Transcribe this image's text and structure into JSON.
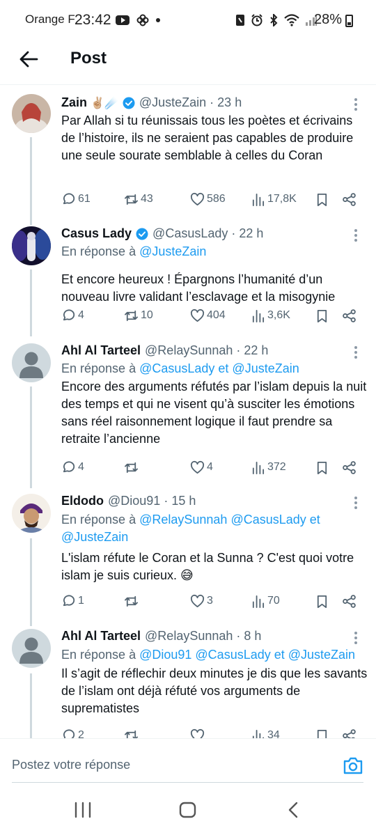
{
  "status_bar": {
    "carrier": "Orange F",
    "time": "23:42",
    "battery": "28%"
  },
  "header": {
    "title": "Post"
  },
  "tweets": [
    {
      "name": "Zain",
      "name_emoji": "✌🏼☄️",
      "verified": true,
      "handle": "@JusteZain",
      "time": "· 23 h",
      "reply_prefix": "",
      "reply_mentions": [],
      "text": "Par Allah si tu réunissais tous les poètes et écrivains de l’histoire, ils ne seraient pas capables de produire une seule sourate semblable à celles du Coran",
      "replies": "61",
      "retweets": "43",
      "likes": "586",
      "views": "17,8K"
    },
    {
      "name": "Casus Lady",
      "verified": true,
      "handle": "@CasusLady",
      "time": "· 22 h",
      "reply_prefix": "En réponse à",
      "reply_mentions": [
        "@JusteZain"
      ],
      "text": "Et encore heureux ! Épargnons l’humanité d’un nouveau livre validant l’esclavage et la misogynie",
      "replies": "4",
      "retweets": "10",
      "likes": "404",
      "views": "3,6K"
    },
    {
      "name": "Ahl Al Tarteel",
      "verified": false,
      "handle": "@RelaySunnah",
      "time": "· 22 h",
      "reply_prefix": "En réponse à",
      "reply_line1": "@CasusLady et @JusteZain",
      "text": "Encore des arguments réfutés par l’islam depuis la nuit des temps et qui ne visent qu’à susciter les émotions sans réel raisonnement logique il faut prendre sa retraite l’ancienne",
      "replies": "4",
      "retweets": "",
      "likes": "4",
      "views": "372"
    },
    {
      "name": "Eldodo",
      "verified": false,
      "handle": "@Diou91",
      "time": "· 15 h",
      "reply_prefix": "En réponse à",
      "reply_line1": "@RelaySunnah @CasusLady et",
      "reply_line2": "@JusteZain",
      "text": "L'islam réfute le Coran et la Sunna ? C'est quoi votre islam je suis curieux. 😅",
      "replies": "1",
      "retweets": "",
      "likes": "3",
      "views": "70"
    },
    {
      "name": "Ahl Al Tarteel",
      "verified": false,
      "handle": "@RelaySunnah",
      "time": "· 8 h",
      "reply_prefix": "En réponse à",
      "reply_line1": "@Diou91 @CasusLady et @JusteZain",
      "text": "Il s’agit de réflechir deux minutes je dis que les savants de l’islam ont déjà réfuté vos arguments de suprematistes",
      "replies": "2",
      "retweets": "",
      "likes": "",
      "views": "34"
    }
  ],
  "composer": {
    "placeholder": "Postez votre réponse"
  },
  "colors": {
    "accent": "#1d9bf0",
    "muted": "#536471",
    "text": "#0f1419"
  }
}
